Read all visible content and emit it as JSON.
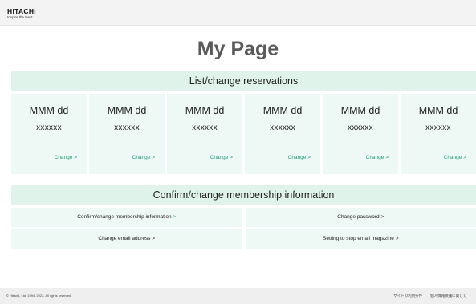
{
  "header": {
    "logo_text": "HITACHI",
    "logo_tagline": "Inspire the Next"
  },
  "page_title": "My Page",
  "reservations": {
    "heading": "List/change reservations",
    "cards": [
      {
        "date": "MMM dd",
        "time": "xxxxxx",
        "link": "Change >"
      },
      {
        "date": "MMM dd",
        "time": "xxxxxx",
        "link": "Change >"
      },
      {
        "date": "MMM dd",
        "time": "xxxxxx",
        "link": "Change >"
      },
      {
        "date": "MMM dd",
        "time": "xxxxxx",
        "link": "Change >"
      },
      {
        "date": "MMM dd",
        "time": "xxxxxx",
        "link": "Change >"
      },
      {
        "date": "MMM dd",
        "time": "xxxxxx",
        "link": "Change >"
      }
    ]
  },
  "membership": {
    "heading": "Confirm/change membership information",
    "links": {
      "confirm_text": "Confirm/change membership information",
      "confirm_arrow": ">",
      "change_password": "Change password >",
      "change_email": "Change email address >",
      "stop_magazine": "Setting to stop email magazine >"
    }
  },
  "footer": {
    "copyright": "© Hitachi, Ltd. 1994, 2023. All rights reserved.",
    "terms_link": "サイトの利用条件",
    "privacy_link": "個人情報保護に関して"
  },
  "colors": {
    "accent": "#1ea07a",
    "section_bg": "#dff3ea",
    "card_bg": "#eef8f4"
  }
}
